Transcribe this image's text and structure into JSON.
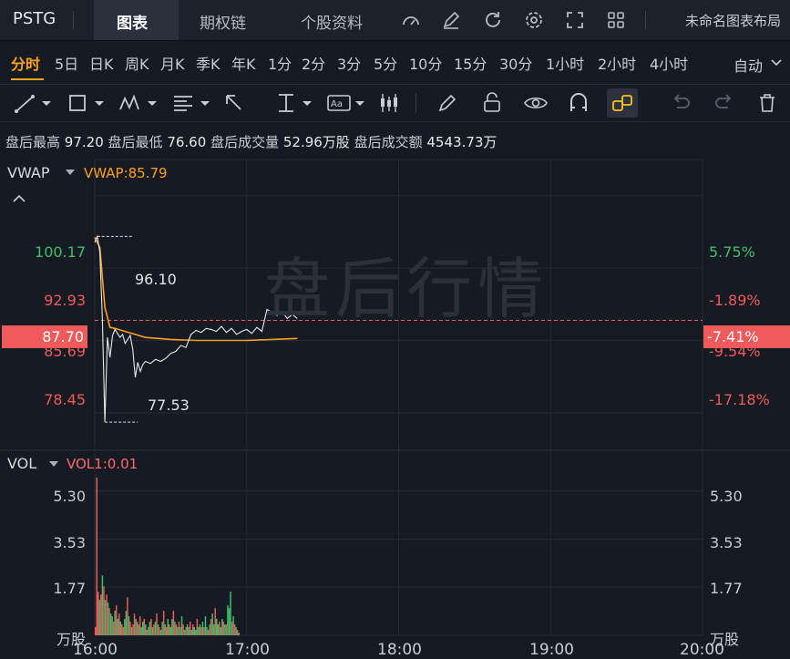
{
  "topbar": {
    "symbol": "PSTG",
    "tabs": [
      "图表",
      "期权链",
      "个股资料"
    ],
    "active_tab": "图表",
    "icons": [
      "gauge-icon",
      "edit-icon",
      "refresh-icon",
      "settings-icon",
      "fullscreen-icon",
      "grid-icon"
    ],
    "layout_name": "未命名图表布局"
  },
  "periods": {
    "items": [
      "分时",
      "5日",
      "日K",
      "周K",
      "月K",
      "季K",
      "年K",
      "1分",
      "2分",
      "3分",
      "5分",
      "10分",
      "15分",
      "30分",
      "1小时",
      "2小时",
      "4小时"
    ],
    "active": "分时",
    "mode": "自动"
  },
  "toolbar": {
    "icons": [
      "line-tool-icon",
      "rectangle-tool-icon",
      "pattern-tool-icon",
      "fibonacci-tool-icon",
      "arrow-tool-icon",
      "measure-tool-icon",
      "text-tool-icon",
      "candle-tool-icon",
      "brush-icon",
      "lock-icon",
      "eye-icon",
      "magnet-icon",
      "link-icon",
      "undo-icon",
      "redo-icon",
      "trash-icon"
    ]
  },
  "stats": {
    "high_label": "盘后最高",
    "high": "97.20",
    "low_label": "盘后最低",
    "low": "76.60",
    "volume_label": "盘后成交量",
    "volume": "52.96万股",
    "amount_label": "盘后成交额",
    "amount": "4543.73万"
  },
  "price_panel": {
    "indicator": "VWAP",
    "indicator_value": "VWAP:85.79",
    "watermark": "盘后行情",
    "y_left": [
      "100.17",
      "92.93",
      "85.69",
      "78.45"
    ],
    "y_right": [
      "5.75%",
      "-1.89%",
      "-9.54%",
      "-17.18%"
    ],
    "current_price": "87.70",
    "current_pct": "-7.41%",
    "max_label": "96.10",
    "min_label": "77.53",
    "colors": {
      "up": "#3dbf6a",
      "down": "#f05a5a",
      "vwap": "#ff9f1c",
      "price": "#e6e8ec"
    }
  },
  "volume_panel": {
    "indicator": "VOL",
    "indicator_value": "VOL1:0.01",
    "y_left": [
      "5.30",
      "3.53",
      "1.77"
    ],
    "y_right": [
      "5.30",
      "3.53",
      "1.77"
    ],
    "unit": "万股"
  },
  "x_axis": [
    "16:00",
    "17:00",
    "18:00",
    "19:00",
    "20:00"
  ],
  "chart_data": [
    {
      "type": "line",
      "x_range": [
        "16:00",
        "20:00"
      ],
      "ylim": [
        74.8,
        103.8
      ],
      "series": [
        {
          "name": "VWAP",
          "x": [
            "16:00",
            "16:02",
            "16:04",
            "16:06",
            "16:08",
            "16:12",
            "16:16",
            "16:20",
            "16:25",
            "16:30",
            "16:40",
            "16:50",
            "17:00",
            "17:10",
            "17:20"
          ],
          "values": [
            96.0,
            95.0,
            89.0,
            87.0,
            86.9,
            86.6,
            86.3,
            86.0,
            85.9,
            85.8,
            85.7,
            85.7,
            85.7,
            85.8,
            85.9
          ]
        },
        {
          "name": "Price",
          "x": [
            "16:00",
            "16:01",
            "16:02",
            "16:03",
            "16:04",
            "16:05",
            "16:06",
            "16:07",
            "16:08",
            "16:09",
            "16:10",
            "16:11",
            "16:12",
            "16:13",
            "16:14",
            "16:15",
            "16:16",
            "16:17",
            "16:18",
            "16:19",
            "16:20",
            "16:22",
            "16:24",
            "16:26",
            "16:28",
            "16:30",
            "16:32",
            "16:34",
            "16:36",
            "16:38",
            "16:40",
            "16:42",
            "16:44",
            "16:46",
            "16:48",
            "16:50",
            "16:52",
            "16:54",
            "16:56",
            "16:58",
            "17:00",
            "17:02",
            "17:04",
            "17:06",
            "17:08",
            "17:10",
            "17:12",
            "17:14",
            "17:16",
            "17:18",
            "17:20"
          ],
          "values": [
            95.5,
            96.1,
            94.5,
            88.0,
            77.53,
            86.0,
            84.0,
            86.2,
            86.8,
            86.4,
            86.0,
            86.3,
            85.4,
            85.8,
            86.2,
            84.8,
            82.0,
            83.5,
            82.6,
            83.3,
            83.6,
            83.4,
            83.8,
            83.6,
            83.9,
            84.4,
            84.6,
            85.2,
            85.0,
            86.3,
            86.7,
            86.5,
            86.9,
            86.8,
            86.6,
            87.1,
            86.5,
            86.9,
            86.3,
            86.6,
            86.8,
            86.4,
            87.0,
            86.6,
            88.8,
            88.5,
            88.2,
            88.6,
            87.9,
            88.3,
            87.9
          ]
        }
      ]
    },
    {
      "type": "bar",
      "unit": "万股",
      "ylim": [
        0,
        6.8
      ],
      "x_range": [
        "16:00",
        "20:00"
      ],
      "x_start": "16:00",
      "x_step_min": 0.55,
      "values": [
        0.3,
        5.8,
        1.6,
        1.3,
        1.5,
        2.2,
        1.8,
        1.3,
        1.5,
        1.2,
        1.0,
        0.8,
        0.7,
        0.5,
        0.9,
        1.1,
        0.6,
        0.8,
        0.5,
        0.4,
        0.3,
        0.6,
        0.9,
        1.4,
        0.7,
        0.5,
        0.3,
        0.4,
        0.8,
        0.6,
        0.5,
        0.4,
        0.7,
        0.3,
        0.5,
        0.6,
        0.4,
        0.2,
        0.3,
        0.5,
        0.6,
        0.3,
        0.4,
        0.5,
        0.8,
        0.4,
        0.3,
        0.2,
        0.5,
        0.9,
        0.4,
        0.3,
        0.6,
        0.4,
        0.3,
        0.6,
        0.9,
        0.5,
        0.4,
        0.3,
        0.5,
        0.3,
        0.7,
        0.4,
        0.2,
        0.3,
        0.4,
        0.3,
        0.5,
        0.2,
        0.4,
        0.3,
        0.2,
        0.6,
        0.3,
        0.4,
        0.3,
        0.5,
        0.3,
        0.7,
        0.3,
        0.2,
        0.4,
        0.6,
        0.8,
        0.4,
        1.0,
        0.6,
        0.4,
        0.5,
        0.3,
        0.6,
        0.5,
        0.4,
        0.4,
        1.1,
        1.0,
        1.6,
        0.5,
        0.7,
        0.4,
        0.3,
        0.2,
        0.1
      ],
      "up": [
        false,
        false,
        false,
        true,
        false,
        true,
        false,
        true,
        false,
        true,
        false,
        true,
        true,
        false,
        true,
        false,
        true,
        false,
        true,
        false,
        false,
        true,
        true,
        false,
        true,
        false,
        true,
        false,
        false,
        true,
        false,
        true,
        false,
        true,
        true,
        false,
        true,
        false,
        true,
        true,
        false,
        true,
        false,
        true,
        false,
        true,
        false,
        true,
        true,
        false,
        true,
        false,
        true,
        false,
        true,
        true,
        false,
        true,
        false,
        true,
        false,
        true,
        true,
        false,
        true,
        false,
        true,
        true,
        false,
        true,
        false,
        true,
        true,
        false,
        true,
        true,
        false,
        true,
        false,
        true,
        true,
        false,
        true,
        false,
        true,
        true,
        false,
        true,
        true,
        false,
        true,
        true,
        false,
        true,
        false,
        true,
        true,
        true,
        false,
        true,
        false,
        true,
        false,
        true
      ]
    }
  ]
}
